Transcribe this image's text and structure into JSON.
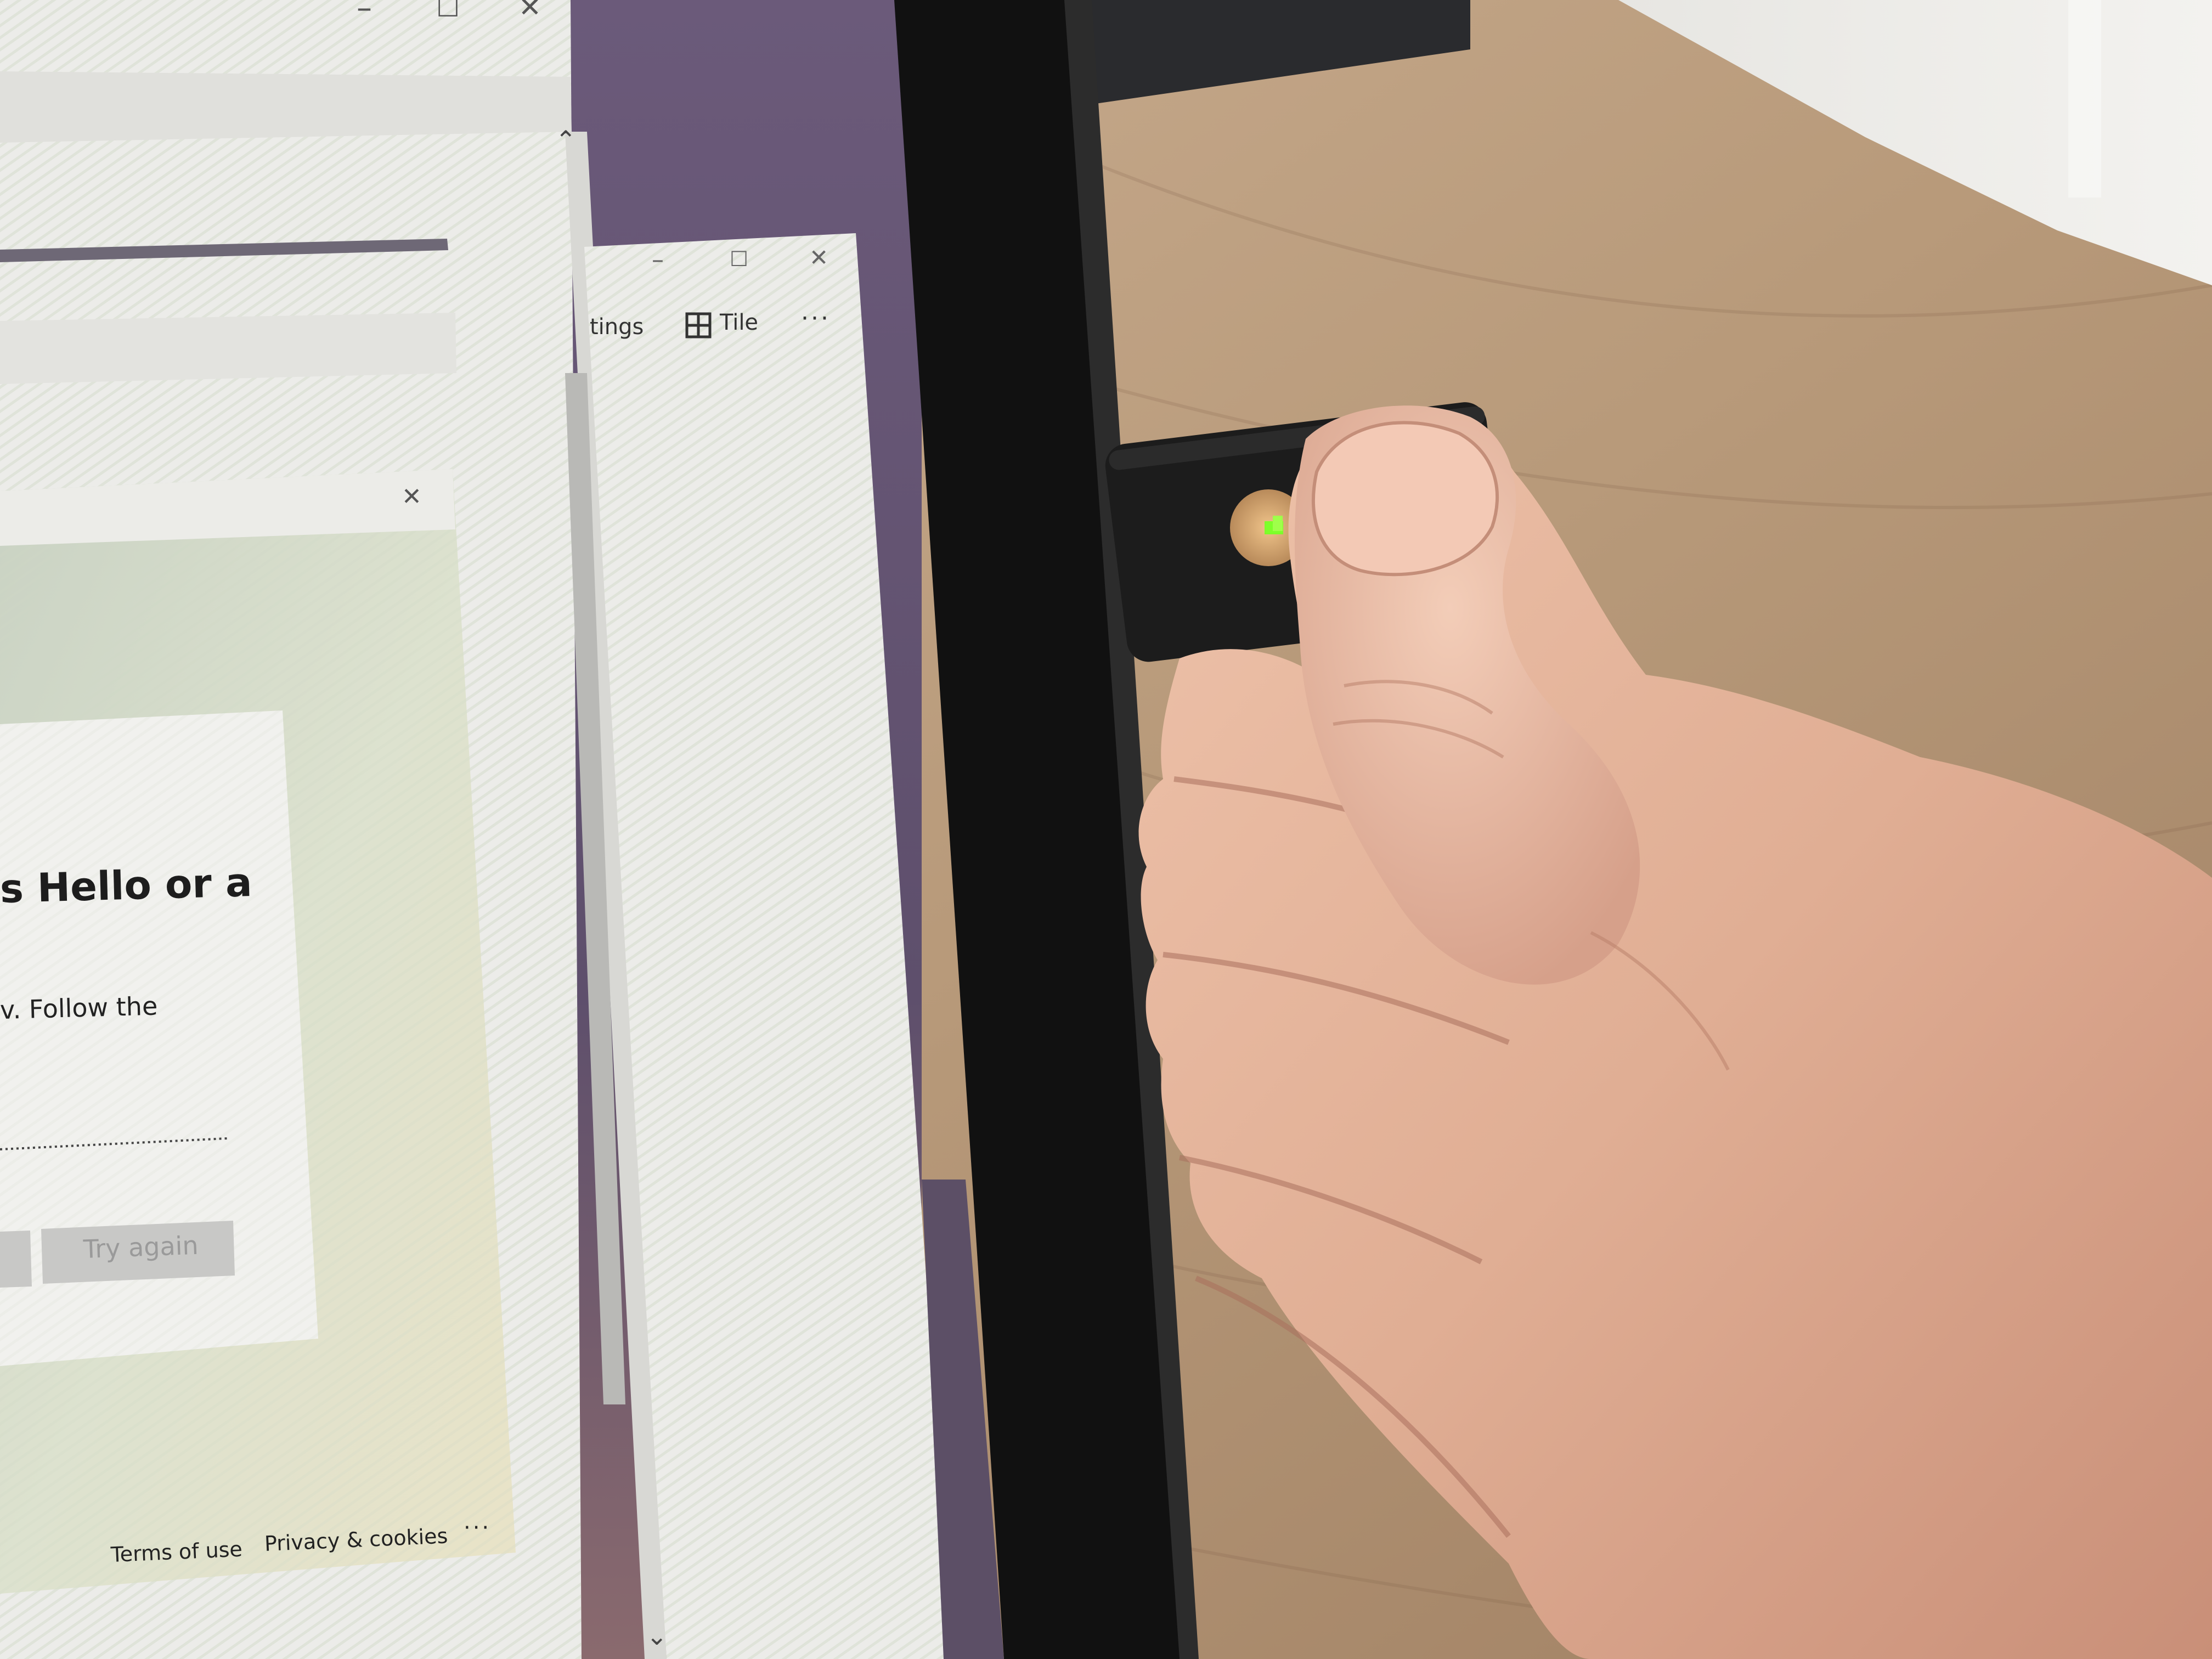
{
  "back_window": {
    "title_controls": [
      "–",
      "☐",
      "✕"
    ]
  },
  "middle_window": {
    "toolbar": {
      "settings_partial": "tings",
      "tile_label": "Tile",
      "more_label": "···"
    },
    "title_controls": [
      "–",
      "☐",
      "✕"
    ]
  },
  "dialog": {
    "close_label": "✕",
    "heading_partial": "s Hello or a",
    "body_partial": "v. Follow the",
    "try_again_label": "Try again",
    "footer": {
      "terms_label": "Terms of use",
      "privacy_label": "Privacy & cookies",
      "more_label": "···"
    }
  },
  "scrollbar": {
    "up_arrow": "⌃",
    "down_arrow": "⌄"
  },
  "security_key": {
    "led_color": "#7dff2a",
    "contact_color": "#d9a86a"
  },
  "colors": {
    "desk": "#b99b78",
    "bezel": "#0f0f0f",
    "skin": "#e2b39a",
    "screen_purple": "#6f5a78",
    "window_bg": "#ececea"
  }
}
